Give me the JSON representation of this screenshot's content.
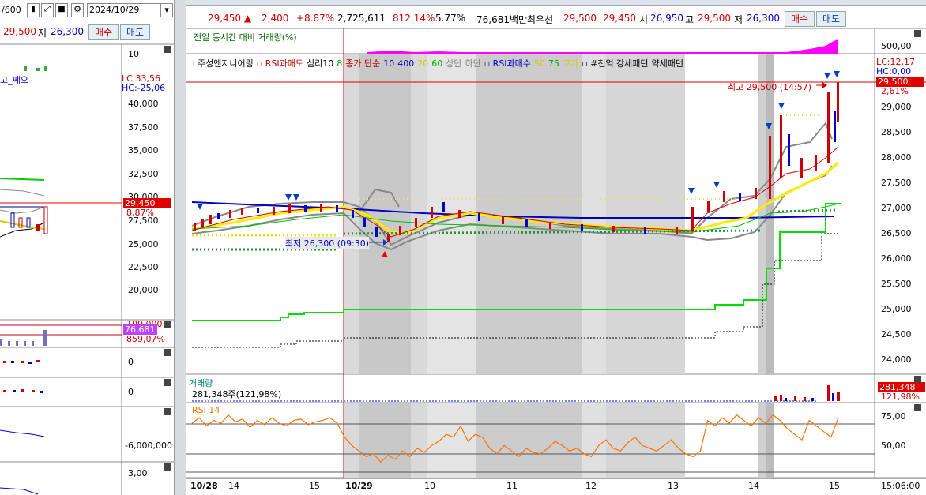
{
  "left": {
    "code_suffix": "/600",
    "date": "2024/10/29",
    "price_a": "29,500",
    "low_label": "저",
    "price_b": "26,300",
    "sell_label": "매수",
    "buy_label": "매도",
    "indicator_name": "고_쎄오",
    "lc": "LC:33,56",
    "hc": "HC:-25,06",
    "yaxis": [
      "10",
      "40,000",
      "37,500",
      "35,000",
      "32,500",
      "30,000",
      "27,500",
      "25,000",
      "22,500",
      "20,000"
    ],
    "cur_price": "29,450",
    "cur_pct": "8,87%",
    "vol_top": "100,000",
    "vol_val": "76,681",
    "vol_pct": "859,07%",
    "zero1": "0",
    "zero2": "0",
    "neg": "-6,000,000",
    "last": "3,00"
  },
  "header": {
    "price": "29,450",
    "change": "2,400",
    "change_pct": "+8.87%",
    "volume": "2,725,611",
    "vol_pct": "812.14%",
    "rate": "5.77%",
    "amount": "76,681백만",
    "best_label": "최우선",
    "bid": "29,500",
    "ask": "29,450",
    "open_label": "시",
    "open": "26,950",
    "high_label": "고",
    "high": "29,500",
    "low_label": "저",
    "low": "26,300",
    "buy_btn": "매수",
    "sell_btn": "매도"
  },
  "vol_compare": {
    "title": "전일 동시간 대비 거래량(%)",
    "axis": "500,00"
  },
  "main_legend": [
    {
      "text": "주성엔지니어링",
      "color": "#000000"
    },
    {
      "text": "RSI과매도",
      "color": "#c00000"
    },
    {
      "text": "심리10",
      "color": "#000000"
    },
    {
      "text": "8",
      "color": "#00a000"
    },
    {
      "text": "종가 단순",
      "color": "#c00000"
    },
    {
      "text": "10",
      "color": "#0000c8"
    },
    {
      "text": "400",
      "color": "#0000c8"
    },
    {
      "text": "20",
      "color": "#d8c800"
    },
    {
      "text": "60",
      "color": "#00b000"
    },
    {
      "text": "상단",
      "color": "#808080"
    },
    {
      "text": "하단",
      "color": "#808080"
    },
    {
      "text": "RSI과매수",
      "color": "#0000c8"
    },
    {
      "text": "50",
      "color": "#d8c800"
    },
    {
      "text": "75",
      "color": "#00a000"
    },
    {
      "text": "고가",
      "color": "#d8c800"
    },
    {
      "text": "#천억 강세패턴",
      "color": "#000000"
    },
    {
      "text": "약세패턴",
      "color": "#000000"
    }
  ],
  "main_chart": {
    "lc": "LC:12,17",
    "hc": "HC:0,00",
    "cur_price": "29,500",
    "cur_pct": "2,61%",
    "high_note": "최고 29,500 (14:57)",
    "low_note": "최저 26,300 (09:30)",
    "yaxis": [
      "29,000",
      "28,500",
      "28,000",
      "27,500",
      "27,000",
      "26,500",
      "26,000",
      "25,500",
      "25,000",
      "24,500",
      "24,000"
    ]
  },
  "volume_panel": {
    "title": "거래량",
    "value": "281,348주(121,98%)",
    "box_val": "281,348",
    "box_pct": "121,98%"
  },
  "rsi_panel": {
    "title": "RSI 14",
    "ticks": [
      "75,00",
      "50,00"
    ]
  },
  "xaxis": {
    "labels": [
      "10/28",
      "14",
      "15",
      "10/29",
      "10",
      "11",
      "12",
      "13",
      "14",
      "15"
    ],
    "time": "15:06:00"
  },
  "chart_data": {
    "type": "candlestick",
    "rsi_values": [
      68,
      72,
      66,
      70,
      68,
      74,
      69,
      71,
      65,
      70,
      67,
      72,
      68,
      66,
      70,
      71,
      67,
      69,
      70,
      72,
      68,
      58,
      52,
      48,
      44,
      46,
      40,
      45,
      42,
      48,
      44,
      50,
      47,
      52,
      55,
      60,
      58,
      66,
      55,
      60,
      58,
      50,
      46,
      52,
      48,
      44,
      50,
      47,
      46,
      50,
      55,
      52,
      48,
      50,
      46,
      44,
      52,
      56,
      50,
      48,
      54,
      58,
      52,
      50,
      48,
      52,
      56,
      50,
      46,
      44,
      48,
      70,
      66,
      72,
      68,
      74,
      70,
      66,
      72,
      68,
      74,
      70,
      64,
      60,
      56,
      70,
      66,
      62,
      58,
      72
    ],
    "rsi_ylim": [
      30,
      80
    ]
  }
}
